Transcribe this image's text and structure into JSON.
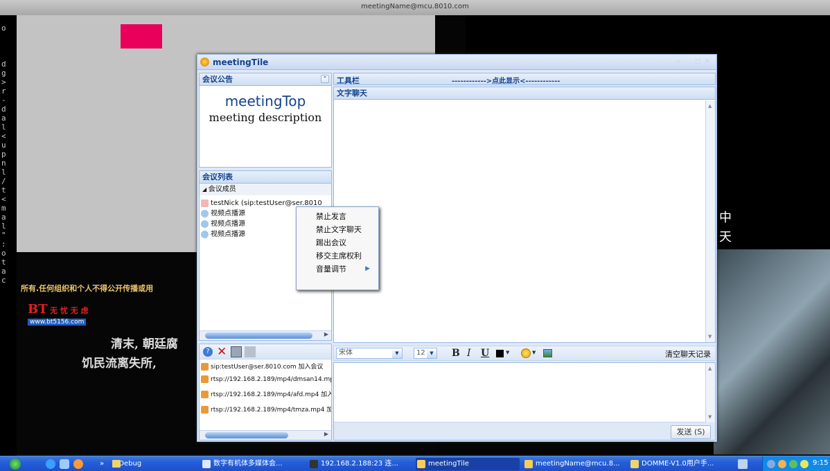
{
  "desktop": {
    "top_title": "meetingName@mcu.8010.com",
    "term_chars": [
      "o",
      "",
      "",
      "",
      "d",
      "g",
      ">",
      "r",
      "-",
      "d",
      "a",
      "l",
      "<",
      "u",
      "p",
      "n",
      "l",
      "/",
      "t",
      "<",
      "m",
      "a",
      "l",
      "\"",
      ":",
      "o",
      "t",
      "a",
      "c"
    ],
    "caption_line1": "清末, 朝廷腐",
    "caption_line2": "饥民流离失所, ",
    "ticker": "所有.任何组织和个人不得公开传播或用",
    "bt_logo": "BT",
    "bt_logo_tail": "无 忧 无 虑",
    "bt_site": "www.bt5156.com",
    "right_glyph1": "中",
    "right_glyph2": "天"
  },
  "window": {
    "title": "meetingTile",
    "notice": {
      "header": "会议公告",
      "meeting_title": "meetingTop",
      "meeting_desc": "meeting description"
    },
    "list": {
      "header": "会议列表",
      "group": "会议成员",
      "members": [
        "testNick (sip:testUser@ser.8010",
        "视频点播源",
        "视频点播源",
        "视频点播源"
      ]
    },
    "log": {
      "entries": [
        "sip:testUser@ser.8010.com 加入会议",
        "rtsp://192.168.2.189/mp4/dmsan14.mp",
        "rtsp://192.168.2.189/mp4/afd.mp4 加入",
        "rtsp://192.168.2.189/mp4/tmza.mp4 加"
      ]
    },
    "toolbar": {
      "label": "工具栏",
      "show_hint": "------------>点此显示<------------"
    },
    "chat": {
      "header": "文字聊天",
      "font_name": "宋体",
      "font_size": "12",
      "bold": "B",
      "italic": "I",
      "underline": "U",
      "clear_label": "清空聊天记录",
      "send_label": "发送 (S)"
    }
  },
  "context_menu": {
    "items": [
      "禁止发言",
      "禁止文字聊天",
      "踢出会议",
      "移交主席权利",
      "音量调节"
    ]
  },
  "taskbar": {
    "items": [
      {
        "label": "» ",
        "sub": "Debug"
      },
      {
        "label": "数字有机体多媒体会..."
      },
      {
        "label": "192.168.2.188:23 连..."
      },
      {
        "label": "meetingTile"
      },
      {
        "label": "meetingName@mcu.8..."
      },
      {
        "label": "DOMME-V1.0用户手..."
      }
    ],
    "clock": "9:15"
  },
  "colors": {
    "accent": "#15428b",
    "pink": "#e8005a",
    "taskbar": "#245edb"
  }
}
